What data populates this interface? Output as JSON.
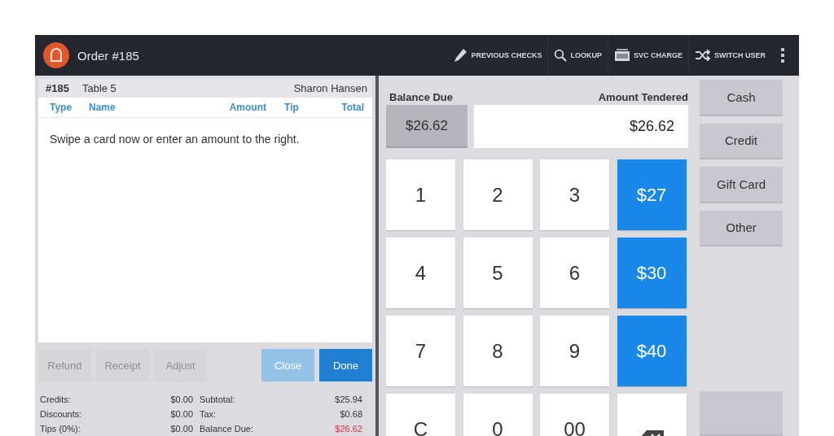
{
  "app_bar": {
    "title": "Order #185",
    "actions": [
      {
        "label": "PREVIOUS CHECKS"
      },
      {
        "label": "LOOKUP"
      },
      {
        "label": "SVC CHARGE"
      },
      {
        "label": "SWITCH USER"
      }
    ]
  },
  "check": {
    "number": "#185",
    "table": "Table 5",
    "server": "Sharon Hansen",
    "columns": [
      "Type",
      "Name",
      "Amount",
      "Tip",
      "Total"
    ],
    "message": "Swipe a card now or enter an amount to the right.",
    "buttons": [
      {
        "label": "Refund",
        "kind": "secondary",
        "disabled": true
      },
      {
        "label": "Receipt",
        "kind": "secondary",
        "disabled": true
      },
      {
        "label": "Adjust",
        "kind": "secondary",
        "disabled": true
      },
      {
        "label": "Close",
        "kind": "primary",
        "disabled": true
      },
      {
        "label": "Done",
        "kind": "primary",
        "disabled": false
      }
    ],
    "summary": [
      {
        "label": "Credits:",
        "value": "$0.00",
        "emphasis": false
      },
      {
        "label": "Subtotal:",
        "value": "$25.94",
        "emphasis": false
      },
      {
        "label": "Discounts:",
        "value": "$0.00",
        "emphasis": false
      },
      {
        "label": "Tax:",
        "value": "$0.68",
        "emphasis": false
      },
      {
        "label": "Tips (0%):",
        "value": "$0.00",
        "emphasis": false
      },
      {
        "label": "Balance Due:",
        "value": "$26.62",
        "emphasis": true
      }
    ]
  },
  "tender": {
    "balance_label": "Balance Due",
    "balance": "$26.62",
    "amount_label": "Amount Tendered",
    "amount": "$26.62",
    "keys": [
      {
        "label": "1",
        "kind": "digit"
      },
      {
        "label": "2",
        "kind": "digit"
      },
      {
        "label": "3",
        "kind": "digit"
      },
      {
        "label": "$27",
        "kind": "quick"
      },
      {
        "label": "4",
        "kind": "digit"
      },
      {
        "label": "5",
        "kind": "digit"
      },
      {
        "label": "6",
        "kind": "digit"
      },
      {
        "label": "$30",
        "kind": "quick"
      },
      {
        "label": "7",
        "kind": "digit"
      },
      {
        "label": "8",
        "kind": "digit"
      },
      {
        "label": "9",
        "kind": "digit"
      },
      {
        "label": "$40",
        "kind": "quick"
      },
      {
        "label": "C",
        "kind": "digit"
      },
      {
        "label": "0",
        "kind": "digit"
      },
      {
        "label": "00",
        "kind": "digit"
      },
      {
        "kind": "backspace"
      }
    ],
    "payment_buttons": [
      "Cash",
      "Credit",
      "Gift Card",
      "Other"
    ]
  }
}
